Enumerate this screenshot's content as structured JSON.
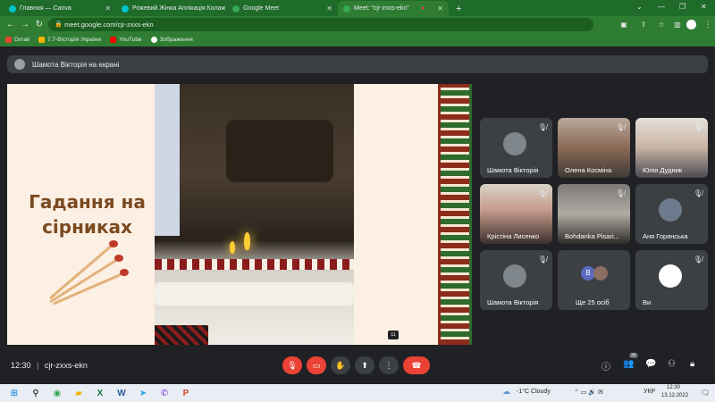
{
  "browser": {
    "tabs": [
      {
        "title": "Главная — Canva",
        "color": "#00c4cc"
      },
      {
        "title": "Рожевий Жінка Аплікація Колаж",
        "color": "#00c4cc"
      },
      {
        "title": "Google Meet",
        "color": "#34a853"
      },
      {
        "title": "Meet: \"cjr-zxxs-ekn\"",
        "color": "#34a853"
      }
    ],
    "new_tab": "+",
    "url": "meet.google.com/cjr-zxxs-ekn",
    "bookmarks": [
      {
        "label": "Gmail",
        "color": "#ea4335"
      },
      {
        "label": "7.7-Вісторія України",
        "color": "#f5b400"
      },
      {
        "label": "YouTube",
        "color": "#ff0000"
      },
      {
        "label": "Зображення",
        "color": "#ffffff"
      }
    ]
  },
  "meet": {
    "presenting_label": "Шамота Вікторія на екрані",
    "slide_title": "Гадання на сірниках",
    "tile_badge": "11",
    "participants": [
      {
        "name": "Шамота Вікторія",
        "type": "avatar",
        "color": "#7f868c"
      },
      {
        "name": "Олена Косміна",
        "type": "video"
      },
      {
        "name": "Юлія Дудник",
        "type": "video"
      },
      {
        "name": "Крістіна Лисенко",
        "type": "video"
      },
      {
        "name": "Bohdanka Pisari...",
        "type": "video"
      },
      {
        "name": "Аня Горянська",
        "type": "avatar",
        "color": "#6b7a8c"
      },
      {
        "name": "Шамота Вікторія",
        "type": "avatar",
        "color": "#7f868c"
      },
      {
        "name": "Ще 25 осіб",
        "type": "more"
      },
      {
        "name": "Ви",
        "type": "avatar",
        "color": "#ffffff"
      }
    ],
    "more_letter": "В",
    "time": "12:30",
    "meeting_code": "cjr-zxxs-ekn",
    "people_count": "35"
  },
  "taskbar": {
    "weather": "-1°C  Cloudy",
    "lang": "УКР",
    "time": "12:30",
    "date": "13.12.2022"
  },
  "colors": {
    "accent_green": "#2e7d32",
    "meet_bg": "#202124",
    "red": "#ea4335"
  }
}
